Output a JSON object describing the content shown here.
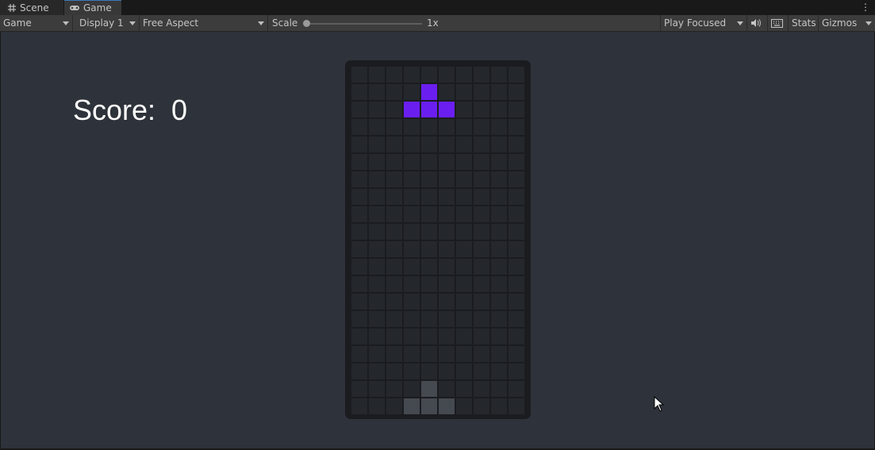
{
  "tabs": [
    {
      "label": "Scene",
      "icon": "grid-hash-icon",
      "active": false
    },
    {
      "label": "Game",
      "icon": "gamepad-icon",
      "active": true
    }
  ],
  "toolbar": {
    "view_select": "Game",
    "display_select": "Display 1",
    "aspect_select": "Free Aspect",
    "scale_label": "Scale",
    "scale_value": "1x",
    "scale_slider_level": 0.0,
    "play_mode_select": "Play Focused",
    "stats_label": "Stats",
    "gizmos_label": "Gizmos"
  },
  "game": {
    "score_text": "Score:  0",
    "board": {
      "columns": 10,
      "rows": 20,
      "active_color": "#6a1ff0",
      "ghost_color": "#454950",
      "empty_color": "#24272c",
      "active_piece": [
        [
          4,
          1
        ],
        [
          3,
          2
        ],
        [
          4,
          2
        ],
        [
          5,
          2
        ]
      ],
      "ghost_piece": [
        [
          4,
          18
        ],
        [
          3,
          19
        ],
        [
          4,
          19
        ],
        [
          5,
          19
        ]
      ]
    }
  },
  "colors": {
    "viewport_bg": "#2e323a",
    "toolbar_bg": "#3c3c3c",
    "tab_accent": "#3a79bb"
  }
}
